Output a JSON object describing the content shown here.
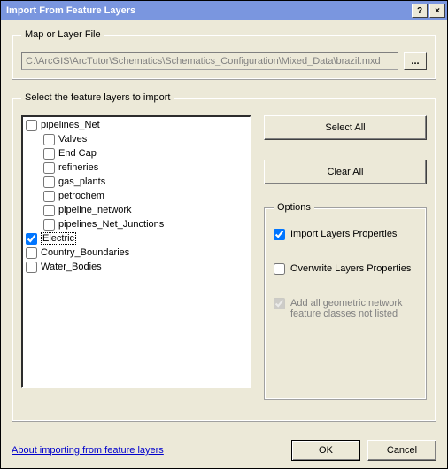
{
  "title": "Import From Feature Layers",
  "titlebar": {
    "help": "?",
    "close": "×"
  },
  "group_file": {
    "legend": "Map or Layer File",
    "path": "C:\\ArcGIS\\ArcTutor\\Schematics\\Schematics_Configuration\\Mixed_Data\\brazil.mxd",
    "browse": "..."
  },
  "group_select": {
    "legend": "Select the feature layers to import",
    "items": [
      {
        "label": "pipelines_Net",
        "checked": false,
        "indent": false
      },
      {
        "label": "Valves",
        "checked": false,
        "indent": true
      },
      {
        "label": "End Cap",
        "checked": false,
        "indent": true
      },
      {
        "label": "refineries",
        "checked": false,
        "indent": true
      },
      {
        "label": "gas_plants",
        "checked": false,
        "indent": true
      },
      {
        "label": "petrochem",
        "checked": false,
        "indent": true
      },
      {
        "label": "pipeline_network",
        "checked": false,
        "indent": true
      },
      {
        "label": "pipelines_Net_Junctions",
        "checked": false,
        "indent": true
      },
      {
        "label": "Electric",
        "checked": true,
        "indent": false,
        "selected": true
      },
      {
        "label": "Country_Boundaries",
        "checked": false,
        "indent": false
      },
      {
        "label": "Water_Bodies",
        "checked": false,
        "indent": false
      }
    ],
    "select_all": "Select All",
    "clear_all": "Clear All"
  },
  "options": {
    "legend": "Options",
    "import_props": {
      "label": "Import Layers Properties",
      "checked": true
    },
    "overwrite_props": {
      "label": "Overwrite Layers Properties",
      "checked": false
    },
    "add_geom": {
      "label": "Add all geometric network feature classes not listed",
      "checked": true,
      "disabled": true
    }
  },
  "footer": {
    "help_link": "About importing from feature layers",
    "ok": "OK",
    "cancel": "Cancel"
  }
}
